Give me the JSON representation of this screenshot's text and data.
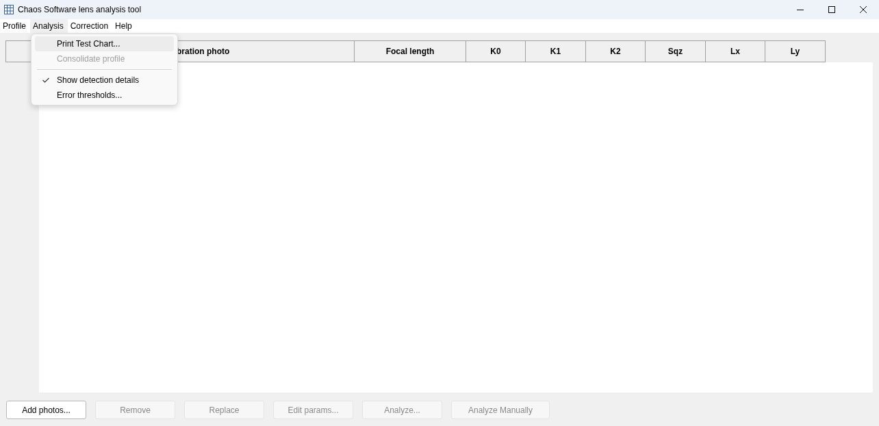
{
  "window": {
    "title": "Chaos Software lens analysis tool"
  },
  "menu_bar": [
    {
      "label": "Profile",
      "selected": false
    },
    {
      "label": "Analysis",
      "selected": true
    },
    {
      "label": "Correction",
      "selected": false
    },
    {
      "label": "Help",
      "selected": false
    }
  ],
  "dropdown": [
    {
      "kind": "item",
      "label": "Print Test Chart...",
      "disabled": false,
      "checked": false,
      "selected": true
    },
    {
      "kind": "item",
      "label": "Consolidate profile",
      "disabled": true,
      "checked": false,
      "selected": false
    },
    {
      "kind": "separator"
    },
    {
      "kind": "item",
      "label": "Show detection details",
      "disabled": false,
      "checked": true,
      "selected": false
    },
    {
      "kind": "item",
      "label": "Error thresholds...",
      "disabled": false,
      "checked": false,
      "selected": false
    }
  ],
  "table": {
    "columns": [
      "",
      "bration photo",
      "Focal length",
      "K0",
      "K1",
      "K2",
      "Sqz",
      "Lx",
      "Ly"
    ]
  },
  "buttons": [
    {
      "label": "Add photos...",
      "disabled": false
    },
    {
      "label": "Remove",
      "disabled": true
    },
    {
      "label": "Replace",
      "disabled": true
    },
    {
      "label": "Edit params...",
      "disabled": true
    },
    {
      "label": "Analyze...",
      "disabled": true
    },
    {
      "label": "Analyze Manually",
      "disabled": true
    }
  ]
}
